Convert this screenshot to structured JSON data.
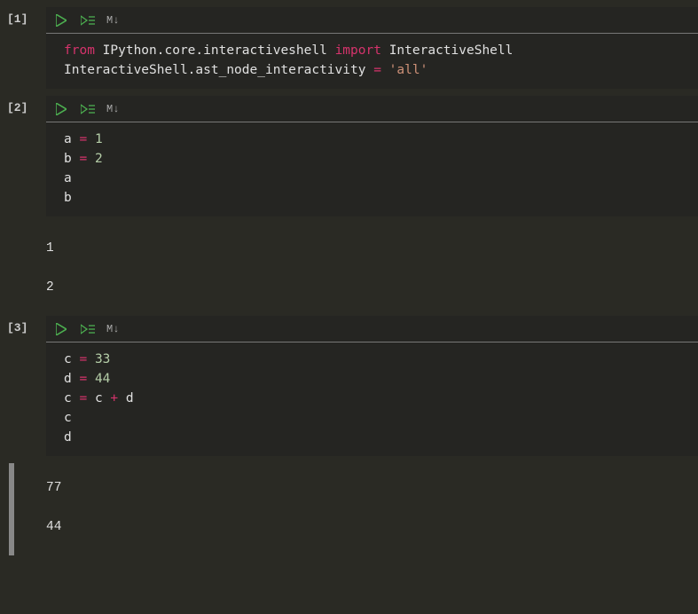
{
  "cells": [
    {
      "exec_label": "[1]",
      "md_label": "M↓",
      "code_html": "<span class='kw'>from</span> <span class='ident'>IPython.core.interactiveshell</span> <span class='kw'>import</span> <span class='ident'>InteractiveShell</span>\n<span class='ident'>InteractiveShell.ast_node_interactivity</span> <span class='op'>=</span> <span class='str'>'all'</span>",
      "outputs": []
    },
    {
      "exec_label": "[2]",
      "md_label": "M↓",
      "code_html": "<span class='ident'>a</span> <span class='op'>=</span> <span class='num'>1</span>\n<span class='ident'>b</span> <span class='op'>=</span> <span class='num'>2</span>\n<span class='ident'>a</span>\n<span class='ident'>b</span>",
      "outputs": [
        "1",
        "2"
      ]
    },
    {
      "exec_label": "[3]",
      "md_label": "M↓",
      "code_html": "<span class='ident'>c</span> <span class='op'>=</span> <span class='num'>33</span>\n<span class='ident'>d</span> <span class='op'>=</span> <span class='num'>44</span>\n<span class='ident'>c</span> <span class='op'>=</span> <span class='ident'>c</span> <span class='op'>+</span> <span class='ident'>d</span>\n<span class='ident'>c</span>\n<span class='ident'>d</span>",
      "outputs": [
        "77",
        "44"
      ],
      "output_bar": true
    }
  ]
}
